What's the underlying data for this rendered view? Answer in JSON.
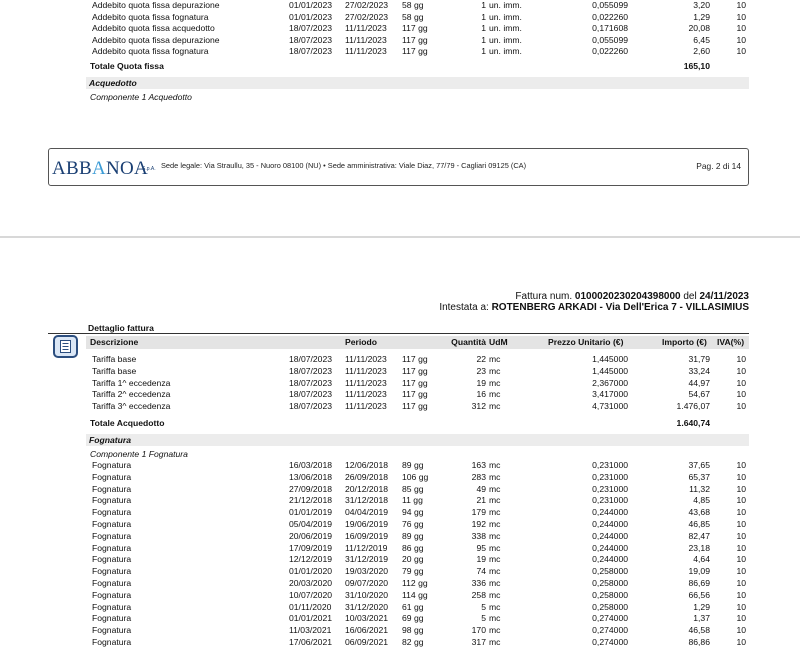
{
  "page1": {
    "rows": [
      {
        "desc": "Addebito quota fissa depurazione",
        "from": "01/01/2023",
        "to": "27/02/2023",
        "days": "58 gg",
        "qty": "1",
        "udm": "un. imm.",
        "unit": "0,055099",
        "amount": "3,20",
        "vat": "10"
      },
      {
        "desc": "Addebito quota fissa fognatura",
        "from": "01/01/2023",
        "to": "27/02/2023",
        "days": "58 gg",
        "qty": "1",
        "udm": "un. imm.",
        "unit": "0,022260",
        "amount": "1,29",
        "vat": "10"
      },
      {
        "desc": "Addebito quota fissa acquedotto",
        "from": "18/07/2023",
        "to": "11/11/2023",
        "days": "117 gg",
        "qty": "1",
        "udm": "un. imm.",
        "unit": "0,171608",
        "amount": "20,08",
        "vat": "10"
      },
      {
        "desc": "Addebito quota fissa depurazione",
        "from": "18/07/2023",
        "to": "11/11/2023",
        "days": "117 gg",
        "qty": "1",
        "udm": "un. imm.",
        "unit": "0,055099",
        "amount": "6,45",
        "vat": "10"
      },
      {
        "desc": "Addebito quota fissa fognatura",
        "from": "18/07/2023",
        "to": "11/11/2023",
        "days": "117 gg",
        "qty": "1",
        "udm": "un. imm.",
        "unit": "0,022260",
        "amount": "2,60",
        "vat": "10"
      }
    ],
    "total_label": "Totale Quota fissa",
    "total_value": "165,10",
    "section": "Acquedotto",
    "component": "Componente 1 Acquedotto",
    "footer": {
      "logo": "ABBANOA",
      "logo_suffix": "S.p.A.",
      "legal": "Sede legale: Via Straullu, 35 - Nuoro 08100 (NU) • Sede amministrativa: Viale Diaz, 77/79 - Cagliari 09125 (CA)",
      "page": "Pag. 2 di 14"
    }
  },
  "page2": {
    "invoice_prefix": "Fattura num.",
    "invoice_number": "0100020230204398000",
    "invoice_del": "del",
    "invoice_date": "24/11/2023",
    "holder_prefix": "Intestata a:",
    "holder": "ROTENBERG ARKADI - Via Dell'Erica 7 - VILLASIMIUS",
    "detail_title": "Dettaglio fattura",
    "icon": "document-icon",
    "headers": {
      "desc": "Descrizione",
      "period": "Periodo",
      "qty": "Quantità",
      "udm": "UdM",
      "unit": "Prezzo Unitario (€)",
      "amount": "Importo (€)",
      "vat": "IVA(%)"
    },
    "acquedotto_rows": [
      {
        "desc": "Tariffa base",
        "from": "18/07/2023",
        "to": "11/11/2023",
        "days": "117 gg",
        "qty": "22",
        "udm": "mc",
        "unit": "1,445000",
        "amount": "31,79",
        "vat": "10"
      },
      {
        "desc": "Tariffa base",
        "from": "18/07/2023",
        "to": "11/11/2023",
        "days": "117 gg",
        "qty": "23",
        "udm": "mc",
        "unit": "1,445000",
        "amount": "33,24",
        "vat": "10"
      },
      {
        "desc": "Tariffa 1^ eccedenza",
        "from": "18/07/2023",
        "to": "11/11/2023",
        "days": "117 gg",
        "qty": "19",
        "udm": "mc",
        "unit": "2,367000",
        "amount": "44,97",
        "vat": "10"
      },
      {
        "desc": "Tariffa 2^ eccedenza",
        "from": "18/07/2023",
        "to": "11/11/2023",
        "days": "117 gg",
        "qty": "16",
        "udm": "mc",
        "unit": "3,417000",
        "amount": "54,67",
        "vat": "10"
      },
      {
        "desc": "Tariffa 3^ eccedenza",
        "from": "18/07/2023",
        "to": "11/11/2023",
        "days": "117 gg",
        "qty": "312",
        "udm": "mc",
        "unit": "4,731000",
        "amount": "1.476,07",
        "vat": "10"
      }
    ],
    "acquedotto_total_label": "Totale Acquedotto",
    "acquedotto_total_value": "1.640,74",
    "fognatura_section": "Fognatura",
    "fognatura_component": "Componente 1 Fognatura",
    "fognatura_rows": [
      {
        "desc": "Fognatura",
        "from": "16/03/2018",
        "to": "12/06/2018",
        "days": "89 gg",
        "qty": "163",
        "udm": "mc",
        "unit": "0,231000",
        "amount": "37,65",
        "vat": "10"
      },
      {
        "desc": "Fognatura",
        "from": "13/06/2018",
        "to": "26/09/2018",
        "days": "106 gg",
        "qty": "283",
        "udm": "mc",
        "unit": "0,231000",
        "amount": "65,37",
        "vat": "10"
      },
      {
        "desc": "Fognatura",
        "from": "27/09/2018",
        "to": "20/12/2018",
        "days": "85 gg",
        "qty": "49",
        "udm": "mc",
        "unit": "0,231000",
        "amount": "11,32",
        "vat": "10"
      },
      {
        "desc": "Fognatura",
        "from": "21/12/2018",
        "to": "31/12/2018",
        "days": "11 gg",
        "qty": "21",
        "udm": "mc",
        "unit": "0,231000",
        "amount": "4,85",
        "vat": "10"
      },
      {
        "desc": "Fognatura",
        "from": "01/01/2019",
        "to": "04/04/2019",
        "days": "94 gg",
        "qty": "179",
        "udm": "mc",
        "unit": "0,244000",
        "amount": "43,68",
        "vat": "10"
      },
      {
        "desc": "Fognatura",
        "from": "05/04/2019",
        "to": "19/06/2019",
        "days": "76 gg",
        "qty": "192",
        "udm": "mc",
        "unit": "0,244000",
        "amount": "46,85",
        "vat": "10"
      },
      {
        "desc": "Fognatura",
        "from": "20/06/2019",
        "to": "16/09/2019",
        "days": "89 gg",
        "qty": "338",
        "udm": "mc",
        "unit": "0,244000",
        "amount": "82,47",
        "vat": "10"
      },
      {
        "desc": "Fognatura",
        "from": "17/09/2019",
        "to": "11/12/2019",
        "days": "86 gg",
        "qty": "95",
        "udm": "mc",
        "unit": "0,244000",
        "amount": "23,18",
        "vat": "10"
      },
      {
        "desc": "Fognatura",
        "from": "12/12/2019",
        "to": "31/12/2019",
        "days": "20 gg",
        "qty": "19",
        "udm": "mc",
        "unit": "0,244000",
        "amount": "4,64",
        "vat": "10"
      },
      {
        "desc": "Fognatura",
        "from": "01/01/2020",
        "to": "19/03/2020",
        "days": "79 gg",
        "qty": "74",
        "udm": "mc",
        "unit": "0,258000",
        "amount": "19,09",
        "vat": "10"
      },
      {
        "desc": "Fognatura",
        "from": "20/03/2020",
        "to": "09/07/2020",
        "days": "112 gg",
        "qty": "336",
        "udm": "mc",
        "unit": "0,258000",
        "amount": "86,69",
        "vat": "10"
      },
      {
        "desc": "Fognatura",
        "from": "10/07/2020",
        "to": "31/10/2020",
        "days": "114 gg",
        "qty": "258",
        "udm": "mc",
        "unit": "0,258000",
        "amount": "66,56",
        "vat": "10"
      },
      {
        "desc": "Fognatura",
        "from": "01/11/2020",
        "to": "31/12/2020",
        "days": "61 gg",
        "qty": "5",
        "udm": "mc",
        "unit": "0,258000",
        "amount": "1,29",
        "vat": "10"
      },
      {
        "desc": "Fognatura",
        "from": "01/01/2021",
        "to": "10/03/2021",
        "days": "69 gg",
        "qty": "5",
        "udm": "mc",
        "unit": "0,274000",
        "amount": "1,37",
        "vat": "10"
      },
      {
        "desc": "Fognatura",
        "from": "11/03/2021",
        "to": "16/06/2021",
        "days": "98 gg",
        "qty": "170",
        "udm": "mc",
        "unit": "0,274000",
        "amount": "46,58",
        "vat": "10"
      },
      {
        "desc": "Fognatura",
        "from": "17/06/2021",
        "to": "06/09/2021",
        "days": "82 gg",
        "qty": "317",
        "udm": "mc",
        "unit": "0,274000",
        "amount": "86,86",
        "vat": "10"
      }
    ]
  }
}
